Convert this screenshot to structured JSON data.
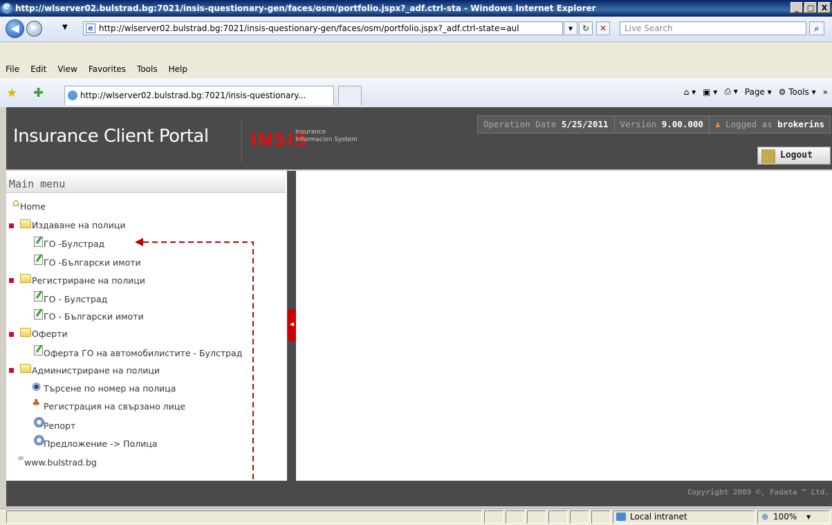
{
  "window": {
    "title": "http://wlserver02.bulstrad.bg:7021/insis-questionary-gen/faces/osm/portfolio.jspx?_adf.ctrl-sta - Windows Internet Explorer",
    "minimize": "_",
    "maximize": "□",
    "close": "X"
  },
  "browser": {
    "address": "http://wlserver02.bulstrad.bg:7021/insis-questionary-gen/faces/osm/portfolio.jspx?_adf.ctrl-state=aul",
    "search_placeholder": "Live Search",
    "menu": [
      "File",
      "Edit",
      "View",
      "Favorites",
      "Tools",
      "Help"
    ],
    "tab_title": "http://wlserver02.bulstrad.bg:7021/insis-questionary...",
    "command_page": "Page",
    "command_tools": "Tools"
  },
  "app": {
    "title": "Insurance Client Portal",
    "logo_text": "INSIS",
    "logo_sub_1": "Insurance",
    "logo_sub_2": "Informacion System",
    "operation_date_label": "Operation Date",
    "operation_date": "5/25/2011",
    "version_label": "Version",
    "version": "9.00.000",
    "logged_label": "Logged as",
    "user": "brokerins",
    "logout": "Logout",
    "copyright": "Copyright 2009 ©, Fadata ™ Ltd."
  },
  "main_menu": {
    "heading": "Main menu",
    "home": "Home",
    "groups": [
      {
        "label": "Издаване на полици",
        "items": [
          "ГО -Булстрад",
          "ГО -Български имоти"
        ]
      },
      {
        "label": "Регистриране на полици",
        "items": [
          "ГО - Булстрад",
          "ГО - Български имоти"
        ]
      },
      {
        "label": "Оферти",
        "items": [
          "Оферта ГО на автомобилистите - Булстрад"
        ]
      },
      {
        "label": "Администриране на полици",
        "items": [
          "Търсене по номер на полица",
          "Регистрация на свързано лице",
          "Репорт",
          "Предложение -> Полица"
        ]
      }
    ],
    "link": "www.bulstrad.bg"
  },
  "status": {
    "zone": "Local intranet",
    "zoom": "100%"
  },
  "colors": {
    "header_bg": "#4a4a4a",
    "logo_red": "#d81414",
    "arrow": "#c00000"
  }
}
